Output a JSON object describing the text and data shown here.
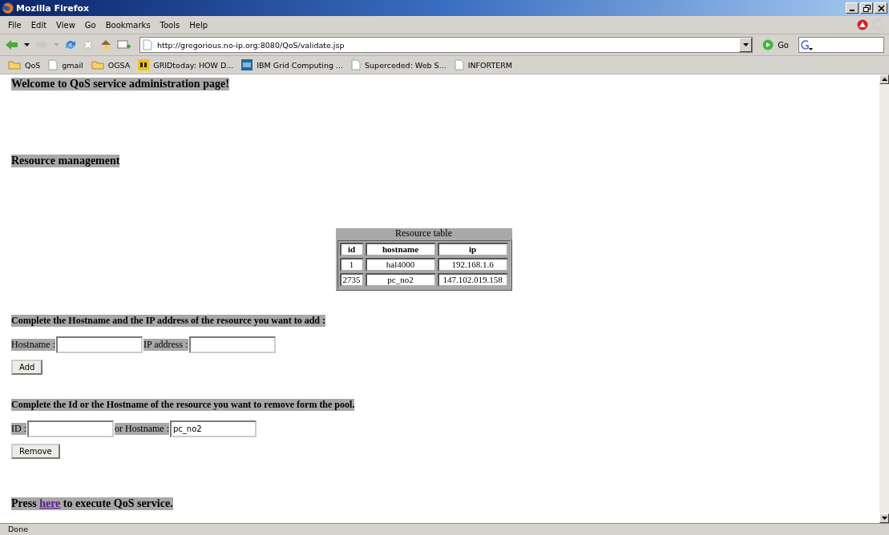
{
  "window": {
    "title": "Mozilla Firefox"
  },
  "menu": [
    "File",
    "Edit",
    "View",
    "Go",
    "Bookmarks",
    "Tools",
    "Help"
  ],
  "address": {
    "value": "http://gregorious.no-ip.org:8080/QoS/validate.jsp"
  },
  "go_button": "Go",
  "bookmarks": [
    {
      "kind": "folder",
      "label": "QoS"
    },
    {
      "kind": "page",
      "label": "gmail"
    },
    {
      "kind": "folder",
      "label": "OGSA"
    },
    {
      "kind": "gt",
      "label": "GRIDtoday: HOW D..."
    },
    {
      "kind": "ibm",
      "label": "IBM Grid Computing ..."
    },
    {
      "kind": "page",
      "label": "Superceded: Web S..."
    },
    {
      "kind": "page",
      "label": "INFORTERM"
    }
  ],
  "page": {
    "welcome": "Welcome to QoS service administration page!",
    "section_title": "Resource management",
    "table": {
      "caption": "Resource table",
      "columns": [
        "id",
        "hostname",
        "ip"
      ],
      "rows": [
        [
          "1",
          "hal4000",
          "192.168.1.6"
        ],
        [
          "2735",
          "pc_no2",
          "147.102.019.158"
        ]
      ]
    },
    "add_form": {
      "instruction": "Complete the Hostname and the IP address of the resource you want to add :",
      "hostname_label": "Hostname :",
      "ip_label": "IP address :",
      "button": "Add"
    },
    "remove_form": {
      "instruction": "Complete the Id or the Hostname of the resource you want to remove form the pool.",
      "id_label": "ID :",
      "hostname_label": "or Hostname :",
      "hostname_value": "pc_no2",
      "button": "Remove"
    },
    "execute": {
      "before": "Press",
      "link": "here",
      "after": "to execute QoS service."
    }
  },
  "status_bar": {
    "text": "Done"
  }
}
